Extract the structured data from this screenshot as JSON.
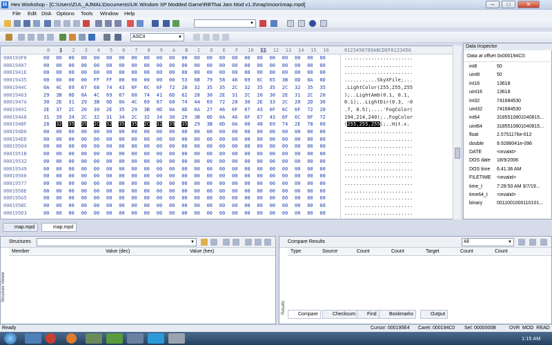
{
  "window": {
    "app_icon": "H",
    "title": "Hex Workshop - [C:\\Users\\ZUL_AJMAL\\Documents\\UK Windom XP Modded Game\\RBThai Jam Mod v1.3\\map\\moon\\map.mpd]",
    "minimize": "–",
    "maximize": "□",
    "close": "✕"
  },
  "menu": [
    "File",
    "Edit",
    "Disk",
    "Options",
    "Tools",
    "Window",
    "Help"
  ],
  "toolbar2": {
    "encoding": "ASCII"
  },
  "hex": {
    "columns": [
      "0",
      "1",
      "2",
      "3",
      "4",
      "5",
      "6",
      "7",
      "8",
      "9",
      "A",
      "B",
      "C",
      "D",
      "E",
      "F",
      "10",
      "11",
      "12",
      "13",
      "14",
      "15",
      "16"
    ],
    "ascii_header": "0123456789ABCDEF0123456",
    "rows": [
      {
        "offset": "000193F0",
        "bytes": [
          "00",
          "00",
          "00",
          "00",
          "00",
          "00",
          "00",
          "00",
          "00",
          "00",
          "00",
          "00",
          "00",
          "00",
          "00",
          "00",
          "00",
          "00",
          "00",
          "00",
          "00",
          "00",
          "00"
        ],
        "ascii": "......................."
      },
      {
        "offset": "00019407",
        "bytes": [
          "00",
          "00",
          "00",
          "00",
          "00",
          "00",
          "00",
          "00",
          "00",
          "00",
          "00",
          "00",
          "00",
          "00",
          "00",
          "00",
          "00",
          "00",
          "00",
          "00",
          "00",
          "00",
          "00"
        ],
        "ascii": "......................."
      },
      {
        "offset": "0001941E",
        "bytes": [
          "00",
          "00",
          "00",
          "00",
          "00",
          "00",
          "00",
          "00",
          "00",
          "00",
          "00",
          "00",
          "00",
          "00",
          "00",
          "00",
          "00",
          "00",
          "00",
          "00",
          "00",
          "00",
          "00"
        ],
        "ascii": "......................."
      },
      {
        "offset": "00019435",
        "bytes": [
          "00",
          "00",
          "00",
          "00",
          "FF",
          "FF",
          "00",
          "90",
          "00",
          "00",
          "00",
          "53",
          "6B",
          "79",
          "58",
          "46",
          "69",
          "6C",
          "65",
          "3B",
          "0D",
          "0A",
          "0D"
        ],
        "ascii": "...........SkyXFile;..."
      },
      {
        "offset": "0001944C",
        "bytes": [
          "0A",
          "4C",
          "69",
          "67",
          "68",
          "74",
          "43",
          "6F",
          "6C",
          "6F",
          "72",
          "28",
          "32",
          "35",
          "35",
          "2C",
          "32",
          "35",
          "35",
          "2C",
          "32",
          "35",
          "35"
        ],
        "ascii": ".LightColor(255,255,255"
      },
      {
        "offset": "00019463",
        "bytes": [
          "29",
          "3B",
          "0D",
          "0A",
          "4C",
          "69",
          "67",
          "68",
          "74",
          "41",
          "6D",
          "62",
          "28",
          "30",
          "2E",
          "31",
          "2C",
          "20",
          "30",
          "2E",
          "31",
          "2C",
          "20"
        ],
        "ascii": ");..LightAmb(0.1, 0.1, "
      },
      {
        "offset": "0001947A",
        "bytes": [
          "30",
          "2E",
          "31",
          "29",
          "3B",
          "0D",
          "0A",
          "4C",
          "69",
          "67",
          "68",
          "74",
          "44",
          "69",
          "72",
          "28",
          "30",
          "2E",
          "33",
          "2C",
          "20",
          "2D",
          "30"
        ],
        "ascii": "0.1);..LightDir(0.3, -0"
      },
      {
        "offset": "00019491",
        "bytes": [
          "2E",
          "37",
          "2C",
          "20",
          "30",
          "2E",
          "35",
          "29",
          "3B",
          "0D",
          "0A",
          "0D",
          "0A",
          "27",
          "46",
          "6F",
          "67",
          "43",
          "6F",
          "6C",
          "6F",
          "72",
          "28"
        ],
        "ascii": ".7, 0.5);....'FogColor("
      },
      {
        "offset": "000194A8",
        "bytes": [
          "31",
          "39",
          "34",
          "2C",
          "32",
          "31",
          "34",
          "2C",
          "32",
          "34",
          "30",
          "29",
          "3B",
          "0D",
          "0A",
          "46",
          "6F",
          "67",
          "43",
          "6F",
          "6C",
          "6F",
          "72"
        ],
        "ascii": "194,214,240);..FogColor"
      },
      {
        "offset": "000194BF",
        "bytes": [
          "28",
          "32",
          "35",
          "35",
          "2C",
          "32",
          "35",
          "35",
          "2C",
          "32",
          "35",
          "35",
          "29",
          "3B",
          "0D",
          "0A",
          "00",
          "48",
          "69",
          "74",
          "2E",
          "78",
          "00"
        ],
        "ascii_pre": "(",
        "ascii_hl": "255,255,255",
        "ascii_post": ");..Hit.x."
      },
      {
        "offset": "000194D6",
        "bytes": [
          "00",
          "00",
          "00",
          "00",
          "00",
          "00",
          "00",
          "00",
          "00",
          "00",
          "00",
          "00",
          "00",
          "00",
          "00",
          "00",
          "00",
          "00",
          "00",
          "00",
          "00",
          "00",
          "00"
        ],
        "ascii": "......................."
      },
      {
        "offset": "000194ED",
        "bytes": [
          "00",
          "00",
          "00",
          "00",
          "00",
          "00",
          "00",
          "00",
          "00",
          "00",
          "00",
          "00",
          "00",
          "00",
          "00",
          "00",
          "00",
          "00",
          "00",
          "00",
          "00",
          "00",
          "00"
        ],
        "ascii": "......................."
      },
      {
        "offset": "00019504",
        "bytes": [
          "00",
          "00",
          "00",
          "00",
          "00",
          "00",
          "00",
          "00",
          "00",
          "00",
          "00",
          "00",
          "00",
          "00",
          "00",
          "00",
          "00",
          "00",
          "00",
          "00",
          "00",
          "00",
          "00"
        ],
        "ascii": "......................."
      },
      {
        "offset": "0001951B",
        "bytes": [
          "00",
          "00",
          "00",
          "00",
          "00",
          "00",
          "00",
          "00",
          "00",
          "00",
          "00",
          "00",
          "00",
          "00",
          "00",
          "00",
          "00",
          "00",
          "00",
          "00",
          "00",
          "00",
          "00"
        ],
        "ascii": "......................."
      },
      {
        "offset": "00019532",
        "bytes": [
          "00",
          "00",
          "00",
          "00",
          "00",
          "00",
          "00",
          "00",
          "00",
          "00",
          "00",
          "00",
          "00",
          "00",
          "00",
          "00",
          "00",
          "00",
          "00",
          "00",
          "00",
          "00",
          "00"
        ],
        "ascii": "......................."
      },
      {
        "offset": "00019549",
        "bytes": [
          "00",
          "00",
          "00",
          "00",
          "00",
          "00",
          "00",
          "00",
          "00",
          "00",
          "00",
          "00",
          "00",
          "00",
          "00",
          "00",
          "00",
          "00",
          "00",
          "00",
          "00",
          "00",
          "00"
        ],
        "ascii": "......................."
      },
      {
        "offset": "00019560",
        "bytes": [
          "00",
          "00",
          "00",
          "00",
          "00",
          "00",
          "00",
          "00",
          "00",
          "00",
          "00",
          "00",
          "00",
          "00",
          "00",
          "00",
          "00",
          "00",
          "00",
          "00",
          "00",
          "00",
          "00"
        ],
        "ascii": "......................."
      },
      {
        "offset": "00019577",
        "bytes": [
          "00",
          "00",
          "00",
          "00",
          "00",
          "00",
          "00",
          "00",
          "00",
          "00",
          "00",
          "00",
          "00",
          "00",
          "00",
          "00",
          "00",
          "00",
          "00",
          "00",
          "00",
          "00",
          "00"
        ],
        "ascii": "......................."
      },
      {
        "offset": "0001958E",
        "bytes": [
          "00",
          "00",
          "00",
          "00",
          "00",
          "00",
          "00",
          "00",
          "00",
          "00",
          "00",
          "00",
          "00",
          "00",
          "00",
          "00",
          "00",
          "00",
          "00",
          "00",
          "00",
          "00",
          "00"
        ],
        "ascii": "......................."
      },
      {
        "offset": "000195A5",
        "bytes": [
          "00",
          "00",
          "00",
          "00",
          "00",
          "00",
          "00",
          "00",
          "00",
          "00",
          "00",
          "00",
          "00",
          "00",
          "00",
          "00",
          "00",
          "00",
          "00",
          "00",
          "00",
          "00",
          "00"
        ],
        "ascii": "......................."
      },
      {
        "offset": "000195BC",
        "bytes": [
          "00",
          "00",
          "00",
          "00",
          "00",
          "00",
          "00",
          "00",
          "00",
          "00",
          "00",
          "00",
          "00",
          "00",
          "00",
          "00",
          "00",
          "00",
          "00",
          "00",
          "00",
          "00",
          "00"
        ],
        "ascii": "......................."
      },
      {
        "offset": "000195D3",
        "bytes": [
          "00",
          "00",
          "00",
          "00",
          "00",
          "00",
          "00",
          "00",
          "00",
          "00",
          "00",
          "00",
          "00",
          "00",
          "00",
          "00",
          "00",
          "00",
          "00",
          "00",
          "00",
          "00",
          "00"
        ],
        "ascii": "......................."
      }
    ]
  },
  "file_tabs": [
    "map.mpd",
    "map.mpd"
  ],
  "inspector": {
    "title": "Data Inspector",
    "offset_label": "Data at offset 0x000194C0:",
    "rows": [
      {
        "k": "int8",
        "v": "50"
      },
      {
        "k": "uint8",
        "v": "50"
      },
      {
        "k": "int16",
        "v": "13618"
      },
      {
        "k": "uint16",
        "v": "13618"
      },
      {
        "k": "int32",
        "v": "741684530"
      },
      {
        "k": "uint32",
        "v": "741684530"
      },
      {
        "k": "int64",
        "v": "3185510801040815..."
      },
      {
        "k": "uint64",
        "v": "3185510801040815..."
      },
      {
        "k": "float",
        "v": "2.5751176e-012"
      },
      {
        "k": "double",
        "v": "9.9288041e-096"
      },
      {
        "k": "DATE",
        "v": "<invalid>"
      },
      {
        "k": "DOS date",
        "v": "18/9/2006"
      },
      {
        "k": "DOS time",
        "v": "6:41:36 AM"
      },
      {
        "k": "FILETIME",
        "v": "<invalid>"
      },
      {
        "k": "time_t",
        "v": "7:28:50 AM 3/7/19..."
      },
      {
        "k": "time64_t",
        "v": "<invalid>"
      },
      {
        "k": "binary",
        "v": "0011001000110101..."
      }
    ]
  },
  "structures": {
    "label": "Structures",
    "side_title": "Structure Viewer",
    "col_member": "Member",
    "col_dec": "Value (dec)",
    "col_hex": "Value (hex)"
  },
  "compare": {
    "title": "Compare Results",
    "filter": "All",
    "side_title": "Results",
    "cols": [
      "Type",
      "Source",
      "Count",
      "Count",
      "Target",
      "Count",
      "Count"
    ],
    "tabs": [
      "Compare",
      "Checksum",
      "Find",
      "Bookmarks",
      "Output"
    ]
  },
  "status": {
    "ready": "Ready",
    "cursor": "Cursor: 000195E4",
    "caret": "Caret: 000194C0",
    "sel": "Sel: 0000000B",
    "flags": "OVR  MOD  READ"
  },
  "taskbar": {
    "time": "1:15 AM"
  }
}
